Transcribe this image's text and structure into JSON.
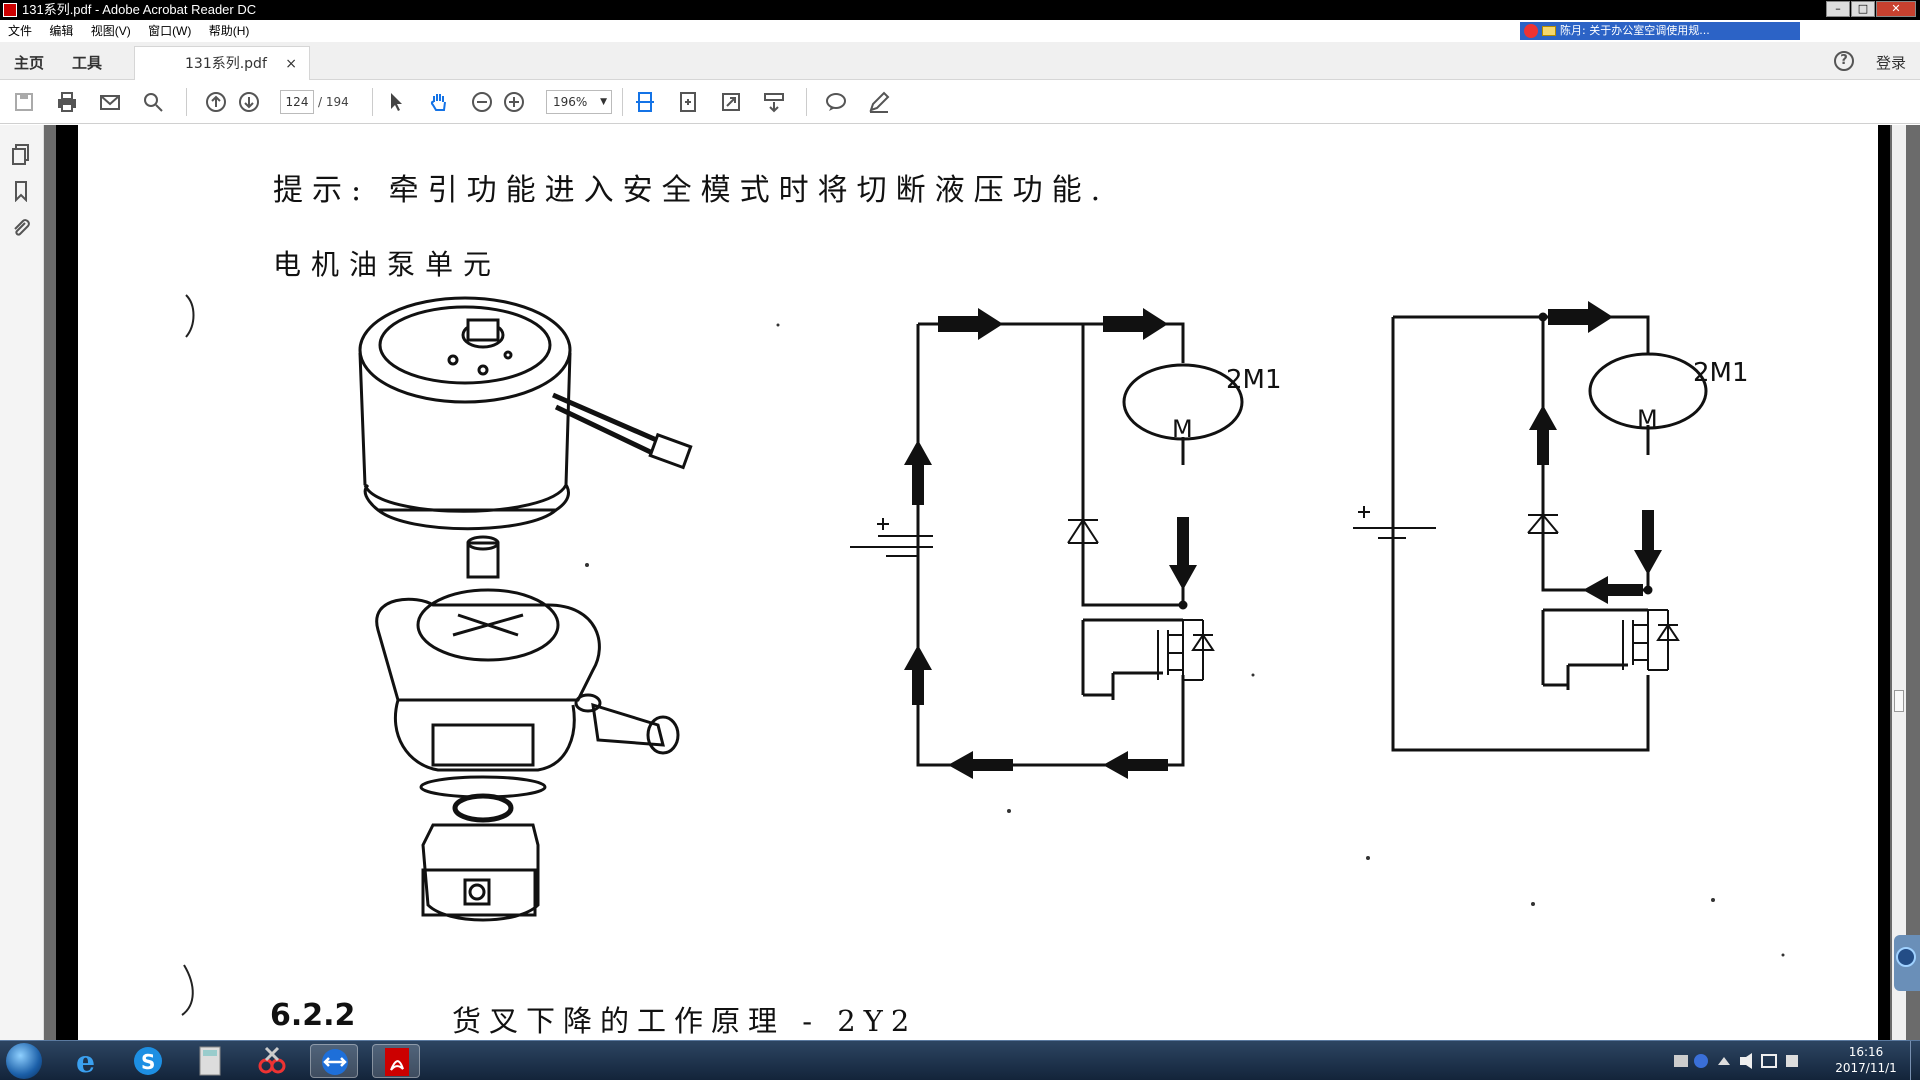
{
  "window": {
    "title": "131系列.pdf - Adobe Acrobat Reader DC"
  },
  "notification": {
    "text": "陈月: 关于办公室空调使用规..."
  },
  "menu": [
    "文件",
    "编辑",
    "视图(V)",
    "窗口(W)",
    "帮助(H)"
  ],
  "tabs": {
    "home": "主页",
    "tools": "工具",
    "doc": "131系列.pdf",
    "close": "×",
    "login": "登录",
    "help": "?"
  },
  "toolbar": {
    "page_current": "124",
    "page_total": "/ 194",
    "zoom": "196%"
  },
  "page": {
    "hint": "提示: 牵引功能进入安全模式时将切断液压功能.",
    "unit_title": "电机油泵单元",
    "motor_label_1": "2M1",
    "motor_label_2": "2M1",
    "motor_symbol": "M",
    "battery_plus": "+",
    "section_number": "6.2.2",
    "section_title": "货叉下降的工作原理 - 2Y2"
  },
  "taskbar": {
    "time": "16:16",
    "date": "2017/11/1"
  },
  "icons": [
    "pdf-icon",
    "save-icon",
    "print-icon",
    "mail-icon",
    "search-icon",
    "page-up-icon",
    "page-down-icon",
    "select-arrow-icon",
    "hand-icon",
    "zoom-out-icon",
    "zoom-in-icon",
    "fit-page-icon",
    "rotate-icon",
    "fullscreen-icon",
    "scroll-mode-icon",
    "comment-icon",
    "sign-icon",
    "pages-icon",
    "bookmark-icon",
    "attachment-icon"
  ]
}
